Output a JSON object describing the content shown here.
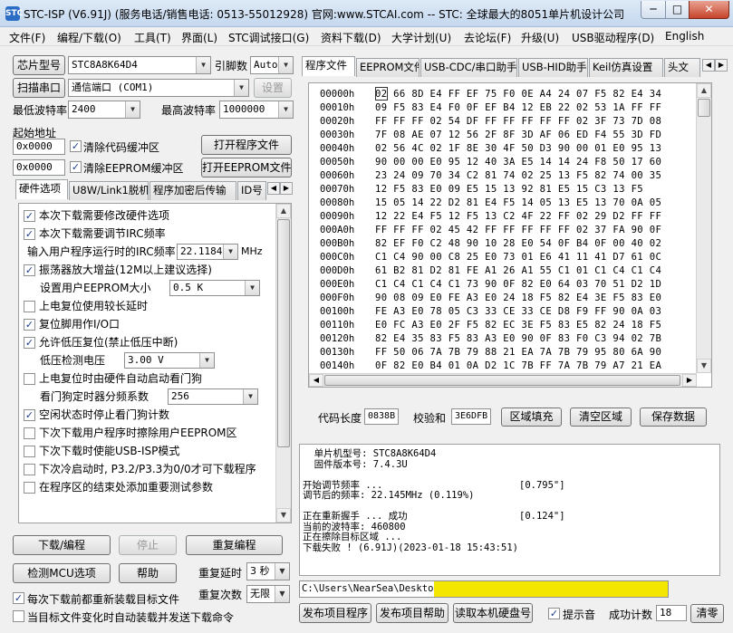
{
  "window": {
    "title": "STC-ISP (V6.91J) (服务电话/销售电话: 0513-55012928) 官网:www.STCAI.com  -- STC: 全球最大的8051单片机设计公司 (...",
    "icon_text": "STC",
    "minimize": "─",
    "maximize": "□",
    "close": "✕"
  },
  "menu": [
    "文件(F)",
    "编程/下载(O)",
    "工具(T)",
    "界面(L)",
    "STC调试接口(G)",
    "资料下载(D)",
    "大学计划(U)",
    "去论坛(F)",
    "升级(U)",
    "USB驱动程序(D)",
    "English"
  ],
  "left": {
    "chip_button": "芯片型号",
    "chip_value": "STC8A8K64D4",
    "pin_label": "引脚数",
    "pin_value": "Auto",
    "scan_button": "扫描串口",
    "port_value": "通信端口 (COM1)",
    "settings_button": "设置",
    "min_baud_label": "最低波特率",
    "min_baud_value": "2400",
    "max_baud_label": "最高波特率",
    "max_baud_value": "1000000",
    "start_addr_label": "起始地址",
    "code_addr": "0x0000",
    "clear_code_label": "清除代码缓冲区",
    "open_program_button": "打开程序文件",
    "eeprom_addr": "0x0000",
    "clear_eeprom_label": "清除EEPROM缓冲区",
    "open_eeprom_button": "打开EEPROM文件",
    "tabs": [
      "硬件选项",
      "U8W/Link1脱机",
      "程序加密后传输",
      "ID号"
    ],
    "spin_left": "◀",
    "spin_right": "▶",
    "options": [
      {
        "label": "本次下载需要修改硬件选项",
        "checked": true
      },
      {
        "label": "本次下载需要调节IRC频率",
        "checked": true
      },
      {
        "label": "输入用户程序运行时的IRC频率",
        "value": "22.1184",
        "unit": "MHz"
      },
      {
        "label": "振荡器放大增益(12M以上建议选择)",
        "checked": true
      },
      {
        "label": "设置用户EEPROM大小",
        "value": "0.5 K"
      },
      {
        "label": "上电复位使用较长延时",
        "checked": false
      },
      {
        "label": "复位脚用作I/O口",
        "checked": true
      },
      {
        "label": "允许低压复位(禁止低压中断)",
        "checked": true
      },
      {
        "label": "低压检测电压",
        "value": "3.00 V"
      },
      {
        "label": "上电复位时由硬件自动启动看门狗",
        "checked": false
      },
      {
        "label": "看门狗定时器分频系数",
        "value": "256"
      },
      {
        "label": "空闲状态时停止看门狗计数",
        "checked": true
      },
      {
        "label": "下次下载用户程序时擦除用户EEPROM区",
        "checked": false
      },
      {
        "label": "下次下载时使能USB-ISP模式",
        "checked": false
      },
      {
        "label": "下次冷启动时, P3.2/P3.3为0/0才可下载程序",
        "checked": false
      },
      {
        "label": "在程序区的结束处添加重要测试参数",
        "checked": false
      }
    ],
    "download_button": "下载/编程",
    "stop_button": "停止",
    "reprogram_button": "重复编程",
    "check_mcu_button": "检测MCU选项",
    "help_button": "帮助",
    "repeat_delay_label": "重复延时",
    "repeat_delay_value": "3 秒",
    "repeat_count_label": "重复次数",
    "repeat_count_value": "无限",
    "reload_each_label": "每次下载前都重新装载目标文件",
    "reload_each_checked": true,
    "auto_load_label": "当目标文件变化时自动装载并发送下载命令",
    "auto_load_checked": false
  },
  "right": {
    "tabs": [
      "程序文件",
      "EEPROM文件",
      "USB-CDC/串口助手",
      "USB-HID助手",
      "Keil仿真设置",
      "头文"
    ],
    "hex_rows": [
      {
        "addr": "00000h",
        "bytes": "02 66 8D E4 FF EF 75 F0 0E A4 24 07 F5 82 E4 34"
      },
      {
        "addr": "00010h",
        "bytes": "09 F5 83 E4 F0 0F EF B4 12 EB 22 02 53 1A FF FF"
      },
      {
        "addr": "00020h",
        "bytes": "FF FF FF 02 54 DF FF FF FF FF FF 02 3F 73 7D 08"
      },
      {
        "addr": "00030h",
        "bytes": "7F 08 AE 07 12 56 2F 8F 3D AF 06 ED F4 55 3D FD"
      },
      {
        "addr": "00040h",
        "bytes": "02 56 4C 02 1F 8E 30 4F 50 D3 90 00 01 E0 95 13"
      },
      {
        "addr": "00050h",
        "bytes": "90 00 00 E0 95 12 40 3A E5 14 14 24 F8 50 17 60"
      },
      {
        "addr": "00060h",
        "bytes": "23 24 09 70 34 C2 81 74 02 25 13 F5 82 74 00 35"
      },
      {
        "addr": "00070h",
        "bytes": "12 F5 83 E0 09 E5 15 13 92 81 E5 15 C3 13 F5"
      },
      {
        "addr": "00080h",
        "bytes": "15 05 14 22 D2 81 E4 F5 14 05 13 E5 13 70 0A 05"
      },
      {
        "addr": "00090h",
        "bytes": "12 22 E4 F5 12 F5 13 C2 4F 22 FF 02 29 D2 FF FF"
      },
      {
        "addr": "000A0h",
        "bytes": "FF FF FF 02 45 42 FF FF FF FF FF 02 37 FA 90 0F"
      },
      {
        "addr": "000B0h",
        "bytes": "82 EF F0 C2 48 90 10 28 E0 54 0F B4 0F 00 40 02"
      },
      {
        "addr": "000C0h",
        "bytes": "C1 C4 90 00 C8 25 E0 73 01 E6 41 11 41 D7 61 0C"
      },
      {
        "addr": "000D0h",
        "bytes": "61 B2 81 D2 81 FE A1 26 A1 55 C1 01 C1 C4 C1 C4"
      },
      {
        "addr": "000E0h",
        "bytes": "C1 C4 C1 C4 C1 73 90 0F 82 E0 64 03 70 51 D2 1D"
      },
      {
        "addr": "000F0h",
        "bytes": "90 08 09 E0 FE A3 E0 24 18 F5 82 E4 3E F5 83 E0"
      },
      {
        "addr": "00100h",
        "bytes": "FE A3 E0 78 05 C3 33 CE 33 CE D8 F9 FF 90 0A 03"
      },
      {
        "addr": "00110h",
        "bytes": "E0 FC A3 E0 2F F5 82 EC 3E F5 83 E5 82 24 18 F5"
      },
      {
        "addr": "00120h",
        "bytes": "82 E4 35 83 F5 83 A3 E0 90 0F 83 F0 C3 94 02 7B"
      },
      {
        "addr": "00130h",
        "bytes": "FF 50 06 7A 7B 79 88 21 EA 7A 7B 79 95 80 6A 90"
      },
      {
        "addr": "00140h",
        "bytes": "0F 82 E0 B4 01 0A D2 1C 7B FF 7A 7B 79 A7 21 EA"
      },
      {
        "addr": "00150h",
        "bytes": "90 0F 82 E0 64 02 60 02 21 E2 D2 1C 90 08 09 E0"
      }
    ],
    "code_length_label": "代码长度",
    "code_length_value": "0838B",
    "checksum_label": "校验和",
    "checksum_value": "3E6DFB",
    "fill_area_button": "区域填充",
    "clear_area_button": "清空区域",
    "save_data_button": "保存数据",
    "log_lines": [
      {
        "text": "  单片机型号: STC8A8K64D4",
        "right": ""
      },
      {
        "text": "  固件版本号: 7.4.3U",
        "right": ""
      },
      {
        "text": "",
        "right": ""
      },
      {
        "text": "开始调节频率 ...",
        "right": "[0.795\"]"
      },
      {
        "text": "调节后的频率: 22.145MHz (0.119%)",
        "right": ""
      },
      {
        "text": "",
        "right": ""
      },
      {
        "text": "正在重新握手 ... 成功",
        "right": "[0.124\"]"
      },
      {
        "text": "当前的波特率: 460800",
        "right": ""
      },
      {
        "text": "正在擦除目标区域 ...",
        "right": ""
      },
      {
        "text": "下载失败 ! (6.91J)(2023-01-18 15:43:51)",
        "right": ""
      }
    ],
    "path_value": "C:\\Users\\NearSea\\Desktop",
    "path_highlight": "#f5e600",
    "publish_program_button": "发布项目程序",
    "publish_help_button": "发布项目帮助",
    "read_disk_button": "读取本机硬盘号",
    "beep_label": "提示音",
    "beep_checked": true,
    "success_count_label": "成功计数",
    "success_count_value": "18",
    "clear_button": "清零"
  }
}
